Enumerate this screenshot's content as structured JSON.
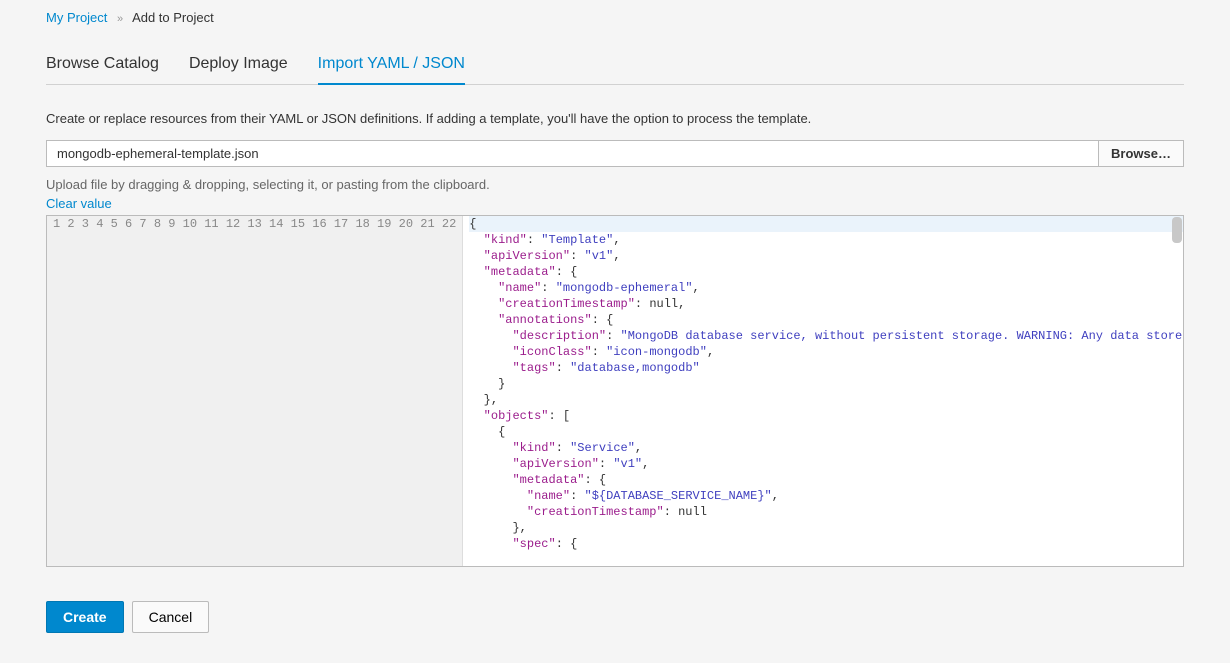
{
  "breadcrumb": {
    "root": "My Project",
    "current": "Add to Project"
  },
  "tabs": {
    "catalog": "Browse Catalog",
    "deploy": "Deploy Image",
    "import": "Import YAML / JSON"
  },
  "description": "Create or replace resources from their YAML or JSON definitions. If adding a template, you'll have the option to process the template.",
  "file": {
    "value": "mongodb-ephemeral-template.json",
    "browse_label": "Browse…"
  },
  "helper": "Upload file by dragging & dropping, selecting it, or pasting from the clipboard.",
  "clear_label": "Clear value",
  "buttons": {
    "create": "Create",
    "cancel": "Cancel"
  },
  "editor": {
    "line_count": 22,
    "lines": [
      {
        "indent": 0,
        "raw": "{",
        "tokens": [
          {
            "t": "punc",
            "v": "{"
          }
        ]
      },
      {
        "indent": 1,
        "tokens": [
          {
            "t": "key",
            "v": "\"kind\""
          },
          {
            "t": "punc",
            "v": ": "
          },
          {
            "t": "str",
            "v": "\"Template\""
          },
          {
            "t": "punc",
            "v": ","
          }
        ]
      },
      {
        "indent": 1,
        "tokens": [
          {
            "t": "key",
            "v": "\"apiVersion\""
          },
          {
            "t": "punc",
            "v": ": "
          },
          {
            "t": "str",
            "v": "\"v1\""
          },
          {
            "t": "punc",
            "v": ","
          }
        ]
      },
      {
        "indent": 1,
        "tokens": [
          {
            "t": "key",
            "v": "\"metadata\""
          },
          {
            "t": "punc",
            "v": ": {"
          }
        ]
      },
      {
        "indent": 2,
        "tokens": [
          {
            "t": "key",
            "v": "\"name\""
          },
          {
            "t": "punc",
            "v": ": "
          },
          {
            "t": "str",
            "v": "\"mongodb-ephemeral\""
          },
          {
            "t": "punc",
            "v": ","
          }
        ]
      },
      {
        "indent": 2,
        "tokens": [
          {
            "t": "key",
            "v": "\"creationTimestamp\""
          },
          {
            "t": "punc",
            "v": ": "
          },
          {
            "t": "null",
            "v": "null"
          },
          {
            "t": "punc",
            "v": ","
          }
        ]
      },
      {
        "indent": 2,
        "tokens": [
          {
            "t": "key",
            "v": "\"annotations\""
          },
          {
            "t": "punc",
            "v": ": {"
          }
        ]
      },
      {
        "indent": 3,
        "tokens": [
          {
            "t": "key",
            "v": "\"description\""
          },
          {
            "t": "punc",
            "v": ": "
          },
          {
            "t": "str",
            "v": "\"MongoDB database service, without persistent storage. WARNING: Any data stored will be lost upon pod destruction. Only use this"
          }
        ]
      },
      {
        "indent": 3,
        "tokens": [
          {
            "t": "key",
            "v": "\"iconClass\""
          },
          {
            "t": "punc",
            "v": ": "
          },
          {
            "t": "str",
            "v": "\"icon-mongodb\""
          },
          {
            "t": "punc",
            "v": ","
          }
        ]
      },
      {
        "indent": 3,
        "tokens": [
          {
            "t": "key",
            "v": "\"tags\""
          },
          {
            "t": "punc",
            "v": ": "
          },
          {
            "t": "str",
            "v": "\"database,mongodb\""
          }
        ]
      },
      {
        "indent": 2,
        "tokens": [
          {
            "t": "punc",
            "v": "}"
          }
        ]
      },
      {
        "indent": 1,
        "tokens": [
          {
            "t": "punc",
            "v": "},"
          }
        ]
      },
      {
        "indent": 1,
        "tokens": [
          {
            "t": "key",
            "v": "\"objects\""
          },
          {
            "t": "punc",
            "v": ": ["
          }
        ]
      },
      {
        "indent": 2,
        "tokens": [
          {
            "t": "punc",
            "v": "{"
          }
        ]
      },
      {
        "indent": 3,
        "tokens": [
          {
            "t": "key",
            "v": "\"kind\""
          },
          {
            "t": "punc",
            "v": ": "
          },
          {
            "t": "str",
            "v": "\"Service\""
          },
          {
            "t": "punc",
            "v": ","
          }
        ]
      },
      {
        "indent": 3,
        "tokens": [
          {
            "t": "key",
            "v": "\"apiVersion\""
          },
          {
            "t": "punc",
            "v": ": "
          },
          {
            "t": "str",
            "v": "\"v1\""
          },
          {
            "t": "punc",
            "v": ","
          }
        ]
      },
      {
        "indent": 3,
        "tokens": [
          {
            "t": "key",
            "v": "\"metadata\""
          },
          {
            "t": "punc",
            "v": ": {"
          }
        ]
      },
      {
        "indent": 4,
        "tokens": [
          {
            "t": "key",
            "v": "\"name\""
          },
          {
            "t": "punc",
            "v": ": "
          },
          {
            "t": "str",
            "v": "\"${DATABASE_SERVICE_NAME}\""
          },
          {
            "t": "punc",
            "v": ","
          }
        ]
      },
      {
        "indent": 4,
        "tokens": [
          {
            "t": "key",
            "v": "\"creationTimestamp\""
          },
          {
            "t": "punc",
            "v": ": "
          },
          {
            "t": "null",
            "v": "null"
          }
        ]
      },
      {
        "indent": 3,
        "tokens": [
          {
            "t": "punc",
            "v": "},"
          }
        ]
      },
      {
        "indent": 3,
        "tokens": [
          {
            "t": "key",
            "v": "\"spec\""
          },
          {
            "t": "punc",
            "v": ": {"
          }
        ]
      },
      {
        "indent": 0,
        "tokens": []
      }
    ]
  }
}
